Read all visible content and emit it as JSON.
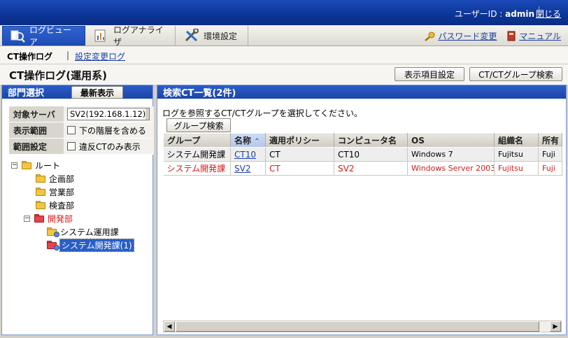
{
  "header": {
    "user_label": "ユーザーID : ",
    "user_name": "admin",
    "close_label": "閉じる"
  },
  "nav": {
    "tabs": [
      {
        "label": "ログビューア",
        "icon": "log-viewer-icon",
        "active": true
      },
      {
        "label": "ログアナライザ",
        "icon": "chart-icon",
        "active": false
      },
      {
        "label": "環境設定",
        "icon": "tools-icon",
        "active": false
      }
    ],
    "password_link": "パスワード変更",
    "manual_link": "マニュアル"
  },
  "subnav": {
    "current": "CT操作ログ",
    "separator": "|",
    "link": "設定変更ログ"
  },
  "page": {
    "title": "CT操作ログ(運用系)",
    "display_settings_button": "表示項目設定",
    "ct_search_button": "CT/CTグループ検索"
  },
  "left": {
    "title": "部門選択",
    "refresh_button": "最新表示",
    "filters": {
      "server_label": "対象サーバ",
      "server_value": "SV2(192.168.1.12)",
      "scope_label": "表示範囲",
      "scope_option": "下の階層を含める",
      "range_label": "範囲設定",
      "range_option": "違反CTのみ表示"
    },
    "tree": {
      "root": "ルート",
      "dept1": "企画部",
      "dept2": "営業部",
      "dept3": "検査部",
      "dept4": "開発部",
      "sub1": "システム運用課",
      "sub2": "システム開発課(1)"
    }
  },
  "right": {
    "title": "検索CT一覧(2件)",
    "info": "ログを参照するCT/CTグループを選択してください。",
    "group_search_button": "グループ検索",
    "columns": [
      "グループ",
      "名称",
      "適用ポリシー",
      "コンピュータ名",
      "OS",
      "組織名",
      "所有"
    ],
    "rows": [
      {
        "group": "システム開発課",
        "name": "CT10",
        "policy": "CT",
        "computer": "CT10",
        "os": "Windows 7",
        "org": "Fujitsu",
        "owner": "Fuji"
      },
      {
        "group": "システム開発課",
        "name": "SV2",
        "policy": "CT",
        "computer": "SV2",
        "os": "Windows Server 2003",
        "org": "Fujitsu",
        "owner": "Fuji"
      }
    ]
  },
  "colors": {
    "header_blue": "#0d3597",
    "violation_red": "#d21a1a",
    "link_blue": "#1a3fa8"
  }
}
